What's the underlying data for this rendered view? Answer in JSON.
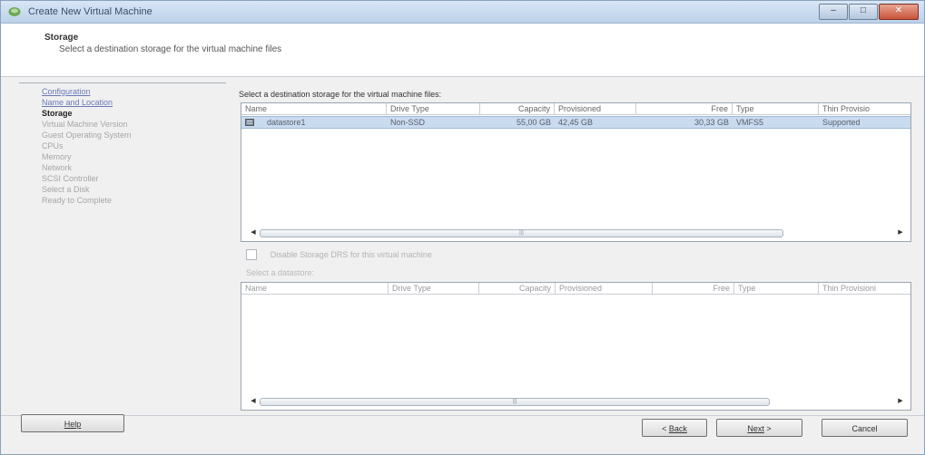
{
  "window": {
    "title": "Create New Virtual Machine"
  },
  "header": {
    "title": "Storage",
    "subtitle": "Select a destination storage for the virtual machine files"
  },
  "nav": {
    "items": [
      {
        "label": "Configuration",
        "state": "link"
      },
      {
        "label": "Name and Location",
        "state": "link"
      },
      {
        "label": "Storage",
        "state": "current"
      },
      {
        "label": "Virtual Machine Version",
        "state": "disabled"
      },
      {
        "label": "Guest Operating System",
        "state": "disabled"
      },
      {
        "label": "CPUs",
        "state": "disabled"
      },
      {
        "label": "Memory",
        "state": "disabled"
      },
      {
        "label": "Network",
        "state": "disabled"
      },
      {
        "label": "SCSI Controller",
        "state": "disabled"
      },
      {
        "label": "Select a Disk",
        "state": "disabled"
      },
      {
        "label": "Ready to Complete",
        "state": "disabled"
      }
    ]
  },
  "storage_prompt": "Select a destination storage for the virtual machine files:",
  "datastore_table": {
    "columns": [
      "Name",
      "Drive Type",
      "Capacity",
      "Provisioned",
      "Free",
      "Type",
      "Thin Provisio"
    ],
    "rows": [
      {
        "name": "datastore1",
        "drive_type": "Non-SSD",
        "capacity": "55,00 GB",
        "provisioned": "42,45 GB",
        "free": "30,33 GB",
        "type": "VMFS5",
        "thin": "Supported"
      }
    ]
  },
  "sdrs_checkbox": {
    "label": "Disable Storage DRS for this virtual machine",
    "checked": false
  },
  "select_datastore_label": "Select a datastore:",
  "lower_table": {
    "columns": [
      "Name",
      "Drive Type",
      "Capacity",
      "Provisioned",
      "Free",
      "Type",
      "Thin Provisioni"
    ]
  },
  "buttons": {
    "help": "Help",
    "back": "Back",
    "next": "Next",
    "cancel": "Cancel"
  },
  "colors": {
    "selection": "#c9dbef",
    "titlebar": "#bcd1ea",
    "close": "#c9533a"
  }
}
